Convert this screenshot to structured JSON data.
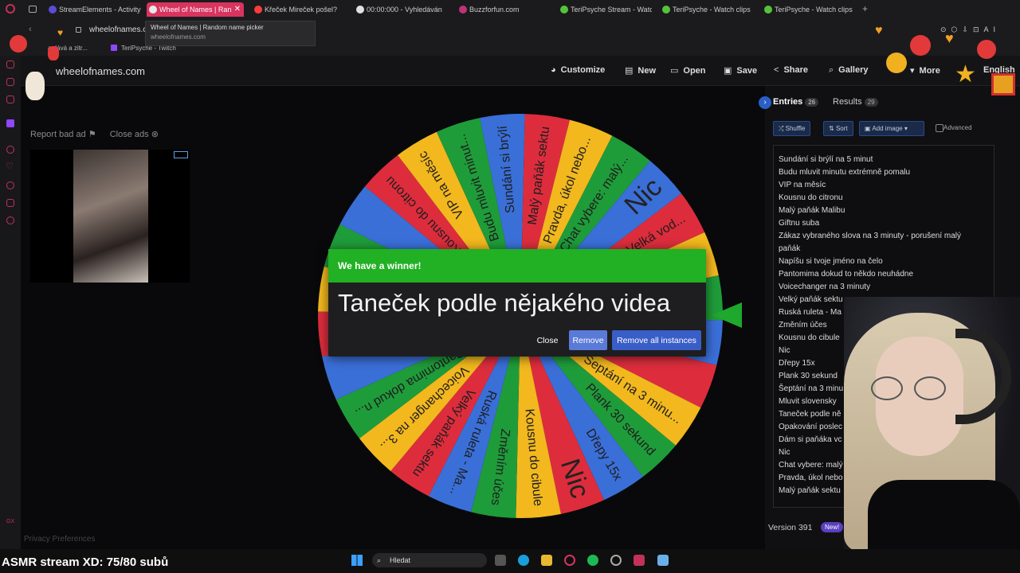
{
  "browser": {
    "tabs": [
      {
        "label": "StreamElements - Activity",
        "active": false,
        "color": "#5a4cd6"
      },
      {
        "label": "Wheel of Names | Ran",
        "active": true,
        "color": "#e8e8e8"
      },
      {
        "label": "Křeček Mireček pošel?",
        "active": false,
        "color": "#ff3b3b"
      },
      {
        "label": "00:00:000 - Vyhledáván",
        "active": false,
        "color": "#e0e0e0"
      },
      {
        "label": "Buzzforfun.com",
        "active": false,
        "color": "#c0327a"
      },
      {
        "label": "TeriPsyche Stream - Watc",
        "active": false,
        "color": "#53c43a"
      },
      {
        "label": "TeriPsyche - Watch clips",
        "active": false,
        "color": "#53c43a"
      },
      {
        "label": "TeriPsyche - Watch clips",
        "active": false,
        "color": "#53c43a"
      }
    ],
    "url": "wheelofnames.co",
    "tooltip_title": "Wheel of Names | Random name picker",
    "tooltip_url": "wheelofnames.com",
    "bookmarks": [
      "a dává a zitr...",
      "TeriPsyche - Twitch"
    ]
  },
  "site": {
    "logo": "wheelofnames.com",
    "nav": [
      {
        "label": "Customize",
        "icon": "palette-icon",
        "glyph": "◕"
      },
      {
        "label": "New",
        "icon": "new-file-icon",
        "glyph": "▤"
      },
      {
        "label": "Open",
        "icon": "folder-open-icon",
        "glyph": "▭"
      },
      {
        "label": "Save",
        "icon": "save-icon",
        "glyph": "▣"
      },
      {
        "label": "Share",
        "icon": "share-icon",
        "glyph": "<"
      },
      {
        "label": "Gallery",
        "icon": "search-icon",
        "glyph": "⌕"
      },
      {
        "label": "More",
        "icon": "more-icon",
        "glyph": "▾"
      }
    ],
    "language": "English"
  },
  "ads": {
    "report": "Report bad ad",
    "close": "Close ads"
  },
  "privacy": "Privacy Preferences",
  "wheel": {
    "labels": [
      "Sundání si brýlí",
      "Malý paňák sektu",
      "Pravda, úkol nebo...",
      "Chat vybere: malý...",
      "Nic",
      "Velká vod...",
      "",
      "",
      "",
      "",
      "Šeptání na 3 minu...",
      "Plank 30 sekund",
      "Dřepy 15x",
      "Nic",
      "Kousnu do cibule",
      "Změním účes",
      "Ruská ruleta - Ma...",
      "Velký paňák sektu",
      "Voicechanger na 3...",
      "Pantomima dokud n...",
      "",
      "",
      "",
      "",
      "",
      "Kousnu do citronu",
      "VIP na měsíc",
      "Budu mluvit minut..."
    ],
    "colors": [
      "#3a6fd8",
      "#dd2d3d",
      "#f2b81e",
      "#1f9c3a"
    ]
  },
  "dialog": {
    "title": "We have a winner!",
    "winner": "Taneček podle nějakého videa",
    "close": "Close",
    "remove": "Remove",
    "remove_all": "Remove all instances"
  },
  "panel": {
    "entries_tab": "Entries",
    "entries_count": "26",
    "results_tab": "Results",
    "results_count": "29",
    "shuffle": "Shuffle",
    "sort": "Sort",
    "add_image": "Add image",
    "advanced": "Advanced",
    "entries": [
      "Sundání si brýlí na 5 minut",
      "Budu mluvit minutu extrémně pomalu",
      "VIP na měsíc",
      "Kousnu do citronu",
      "Malý paňák Malibu",
      "Giftnu suba",
      "Zákaz vybraného slova na 3 minuty - porušení malý",
      "paňák",
      "Napíšu si tvoje jméno na čelo",
      "Pantomima dokud to někdo neuhádne",
      "Voicechanger na 3 minuty",
      "Velký paňák sektu",
      "Ruská ruleta - Ma",
      "Změním účes",
      "Kousnu do cibule",
      "Nic",
      "Dřepy 15x",
      "Plank 30 sekund",
      "Šeptání na 3 minu",
      "Mluvit slovensky",
      "Taneček podle ně",
      "Opakování poslec",
      "Dám si paňáka vc",
      "Nic",
      "Chat vybere: malý",
      "Pravda, úkol nebo",
      "Malý paňák sektu"
    ],
    "version": "Version 391",
    "new_badge": "New!"
  },
  "taskbar": {
    "overlay": "ASMR stream XD: 75/80 subů",
    "search": "Hledat"
  },
  "rail_label": "GX"
}
